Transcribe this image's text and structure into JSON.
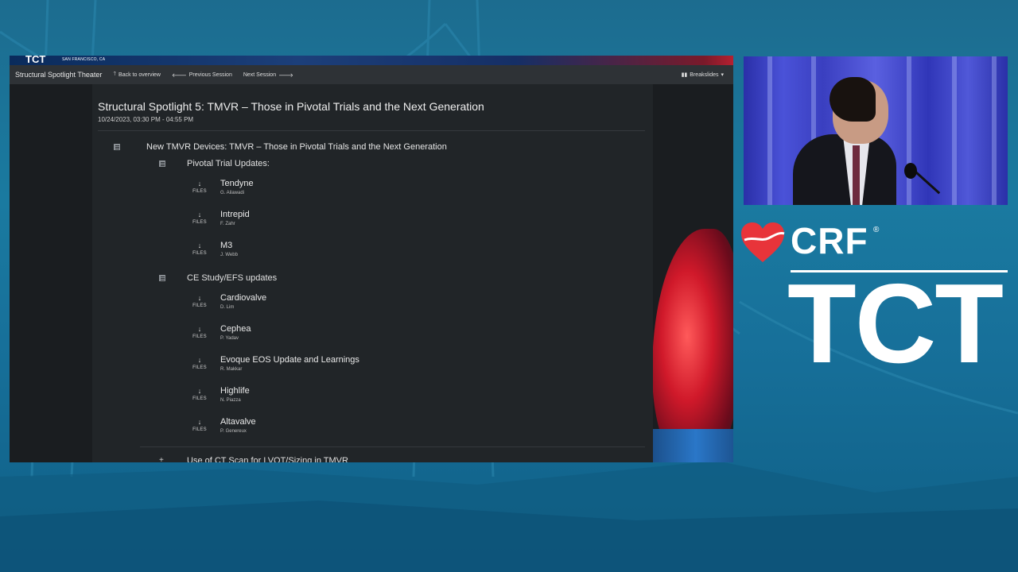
{
  "screen": {
    "logo_fragment": "TCT",
    "location": "SAN FRANCISCO, CA"
  },
  "navbar": {
    "brand": "Structural Spotlight Theater",
    "back_label": "Back to overview",
    "prev_label": "Previous Session",
    "next_label": "Next Session",
    "breakslides_label": "Breakslides"
  },
  "session": {
    "title": "Structural Spotlight 5: TMVR – Those in Pivotal Trials and the Next Generation",
    "date": "10/24/2023, 03:30 PM - 04:55 PM"
  },
  "agenda": {
    "group_title": "New TMVR Devices: TMVR – Those in Pivotal Trials and the Next Generation",
    "files_label": "FILES",
    "sections": [
      {
        "title": "Pivotal Trial Updates:",
        "items": [
          {
            "name": "Tendyne",
            "speaker": "G. Ailawadi"
          },
          {
            "name": "Intrepid",
            "speaker": "F. Zahr"
          },
          {
            "name": "M3",
            "speaker": "J. Webb"
          }
        ]
      },
      {
        "title": "CE Study/EFS updates",
        "items": [
          {
            "name": "Cardiovalve",
            "speaker": "D. Lim"
          },
          {
            "name": "Cephea",
            "speaker": "P. Yadav"
          },
          {
            "name": "Evoque EOS Update and Learnings",
            "speaker": "R. Makkar"
          },
          {
            "name": "Highlife",
            "speaker": "N. Piazza"
          },
          {
            "name": "Altavalve",
            "speaker": "P. Genereux"
          }
        ]
      }
    ],
    "next_section_partial": "Use of CT Scan for LVOT/Sizing in TMVR"
  },
  "branding": {
    "crf": "CRF",
    "registered": "®",
    "tct": "TCT"
  },
  "colors": {
    "background": "#1a7aa0",
    "screen_bg": "#1a1d20",
    "navbar_bg": "#2e3236",
    "panel_bg": "#212528",
    "crf_red": "#e8343a"
  }
}
